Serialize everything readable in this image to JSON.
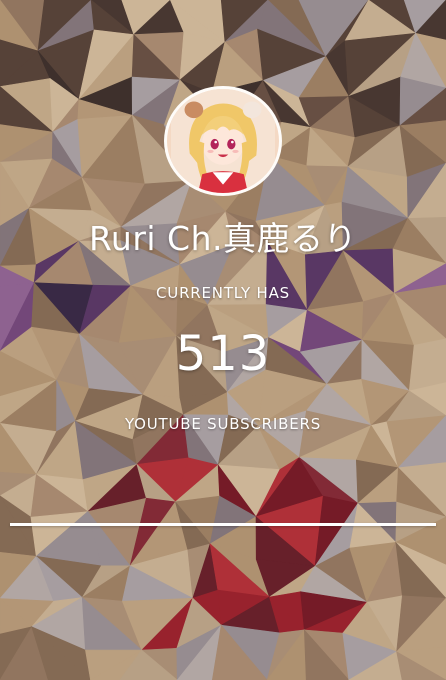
{
  "channel": {
    "name": "Ruri Ch.真鹿るり",
    "avatar_icon": "vtuber-avatar-icon"
  },
  "stats": {
    "prefix_label": "CURRENTLY HAS",
    "count": "513",
    "suffix_label": "YOUTUBE SUBSCRIBERS"
  },
  "colors": {
    "text": "#ffffff",
    "divider": "#ffffff",
    "background_base": "#b9a690"
  }
}
